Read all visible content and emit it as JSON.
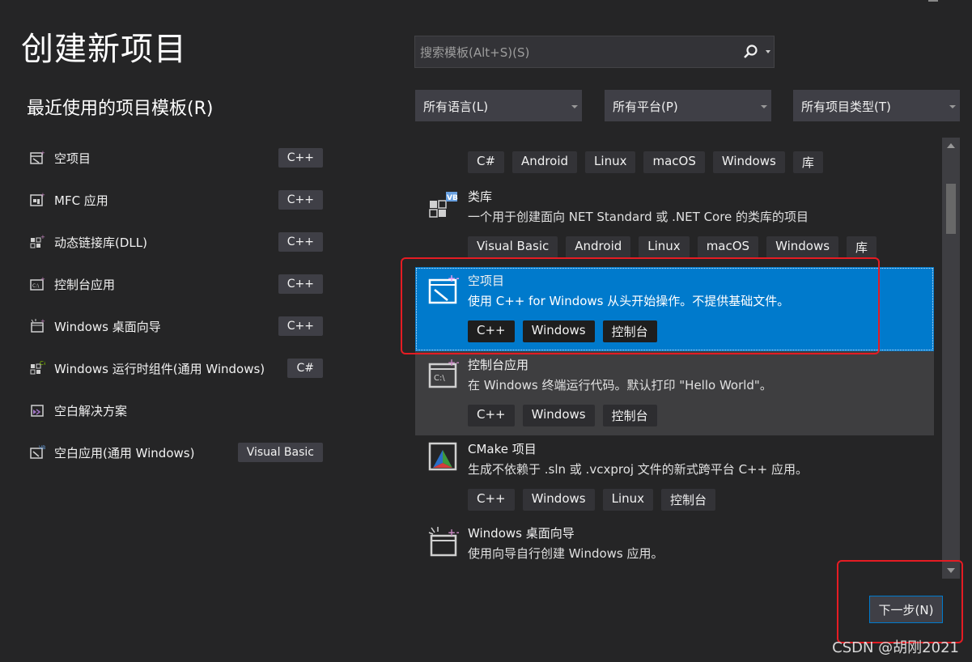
{
  "page_title": "创建新项目",
  "recent": {
    "title": "最近使用的项目模板(R)",
    "items": [
      {
        "label": "空项目",
        "tag": "C++",
        "icon": "empty-project-icon"
      },
      {
        "label": "MFC 应用",
        "tag": "C++",
        "icon": "mfc-app-icon"
      },
      {
        "label": "动态链接库(DLL)",
        "tag": "C++",
        "icon": "dll-icon"
      },
      {
        "label": "控制台应用",
        "tag": "C++",
        "icon": "console-app-icon"
      },
      {
        "label": "Windows 桌面向导",
        "tag": "C++",
        "icon": "desktop-wizard-icon"
      },
      {
        "label": "Windows 运行时组件(通用 Windows)",
        "tag": "C#",
        "icon": "runtime-component-icon"
      },
      {
        "label": "空白解决方案",
        "tag": "",
        "icon": "blank-solution-icon"
      },
      {
        "label": "空白应用(通用 Windows)",
        "tag": "Visual Basic",
        "icon": "blank-app-icon"
      }
    ]
  },
  "search": {
    "placeholder": "搜索模板(Alt+S)(S)"
  },
  "filters": {
    "language": "所有语言(L)",
    "platform": "所有平台(P)",
    "project_type": "所有项目类型(T)"
  },
  "templates": {
    "partial_tags": [
      "C#",
      "Android",
      "Linux",
      "macOS",
      "Windows",
      "库"
    ],
    "items": [
      {
        "name": "类库",
        "desc": "一个用于创建面向 NET Standard 或 .NET Core 的类库的项目",
        "tags": [
          "Visual Basic",
          "Android",
          "Linux",
          "macOS",
          "Windows",
          "库"
        ],
        "icon": "class-library-icon"
      },
      {
        "name": "空项目",
        "desc": "使用 C++ for Windows 从头开始操作。不提供基础文件。",
        "tags": [
          "C++",
          "Windows",
          "控制台"
        ],
        "icon": "empty-project-icon"
      },
      {
        "name": "控制台应用",
        "desc": "在 Windows 终端运行代码。默认打印 \"Hello World\"。",
        "tags": [
          "C++",
          "Windows",
          "控制台"
        ],
        "icon": "console-app-icon"
      },
      {
        "name": "CMake 项目",
        "desc": "生成不依赖于 .sln 或 .vcxproj 文件的新式跨平台 C++ 应用。",
        "tags": [
          "C++",
          "Windows",
          "Linux",
          "控制台"
        ],
        "icon": "cmake-icon"
      },
      {
        "name": "Windows 桌面向导",
        "desc": "使用向导自行创建 Windows 应用。",
        "tags": [],
        "icon": "desktop-wizard-icon"
      }
    ]
  },
  "next_button": "下一步(N)",
  "watermark": "CSDN @胡刚2021",
  "colors": {
    "background": "#252526",
    "selected": "#007acc",
    "highlight": "#e51c23"
  }
}
